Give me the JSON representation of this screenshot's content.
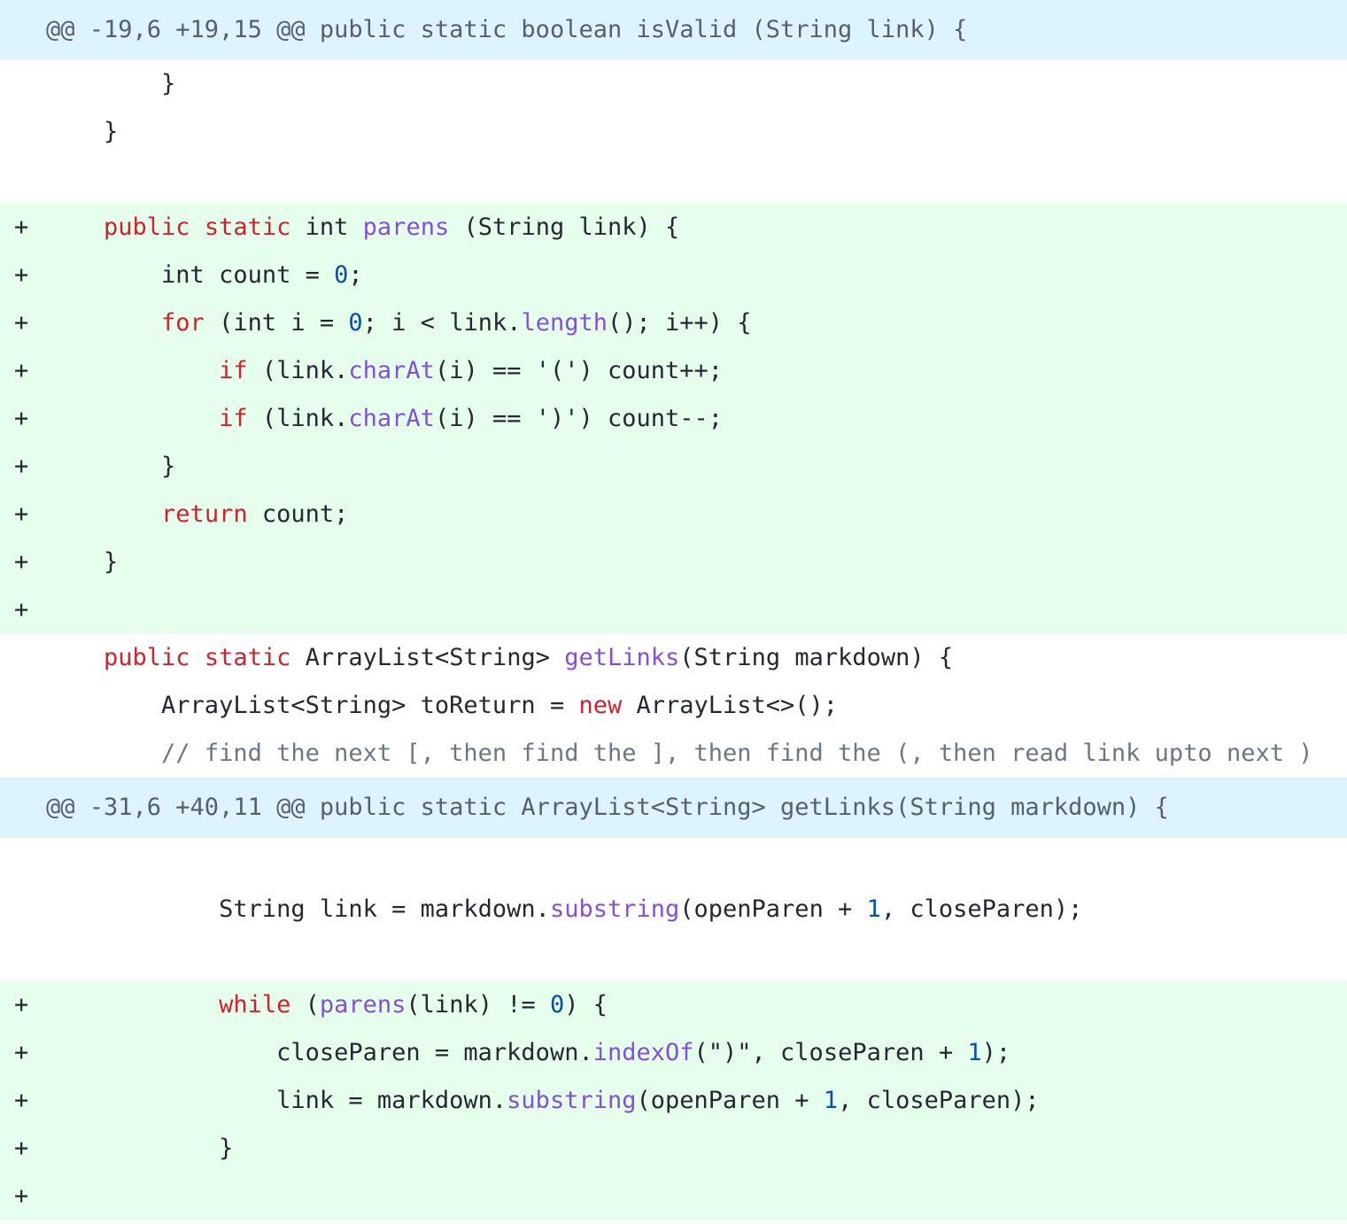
{
  "colors": {
    "hunk_bg": "#ddf4ff",
    "added_bg": "#e6ffec",
    "keyword": "#cf222e",
    "function": "#8250df",
    "number": "#0550ae",
    "comment": "#6e7781",
    "text": "#24292f"
  },
  "blocks": [
    {
      "type": "hunk",
      "text": "@@ -19,6 +19,15 @@ public static boolean isValid (String link) {"
    },
    {
      "type": "ctx",
      "tokens": [
        {
          "t": "p",
          "v": "        }"
        }
      ]
    },
    {
      "type": "ctx",
      "tokens": [
        {
          "t": "p",
          "v": "    }"
        }
      ]
    },
    {
      "type": "blank"
    },
    {
      "type": "add",
      "marker": "+",
      "tokens": [
        {
          "t": "p",
          "v": "    "
        },
        {
          "t": "k",
          "v": "public"
        },
        {
          "t": "p",
          "v": " "
        },
        {
          "t": "k",
          "v": "static"
        },
        {
          "t": "p",
          "v": " int "
        },
        {
          "t": "f",
          "v": "parens"
        },
        {
          "t": "p",
          "v": " (String link) {"
        }
      ]
    },
    {
      "type": "add",
      "marker": "+",
      "tokens": [
        {
          "t": "p",
          "v": "        int count = "
        },
        {
          "t": "n",
          "v": "0"
        },
        {
          "t": "p",
          "v": ";"
        }
      ]
    },
    {
      "type": "add",
      "marker": "+",
      "tokens": [
        {
          "t": "p",
          "v": "        "
        },
        {
          "t": "k",
          "v": "for"
        },
        {
          "t": "p",
          "v": " (int i = "
        },
        {
          "t": "n",
          "v": "0"
        },
        {
          "t": "p",
          "v": "; i < link."
        },
        {
          "t": "f",
          "v": "length"
        },
        {
          "t": "p",
          "v": "(); i++) {"
        }
      ]
    },
    {
      "type": "add",
      "marker": "+",
      "tokens": [
        {
          "t": "p",
          "v": "            "
        },
        {
          "t": "k",
          "v": "if"
        },
        {
          "t": "p",
          "v": " (link."
        },
        {
          "t": "f",
          "v": "charAt"
        },
        {
          "t": "p",
          "v": "(i) == '(') count++;"
        }
      ]
    },
    {
      "type": "add",
      "marker": "+",
      "tokens": [
        {
          "t": "p",
          "v": "            "
        },
        {
          "t": "k",
          "v": "if"
        },
        {
          "t": "p",
          "v": " (link."
        },
        {
          "t": "f",
          "v": "charAt"
        },
        {
          "t": "p",
          "v": "(i) == ')') count--;"
        }
      ]
    },
    {
      "type": "add",
      "marker": "+",
      "tokens": [
        {
          "t": "p",
          "v": "        }"
        }
      ]
    },
    {
      "type": "add",
      "marker": "+",
      "tokens": [
        {
          "t": "p",
          "v": "        "
        },
        {
          "t": "k",
          "v": "return"
        },
        {
          "t": "p",
          "v": " count;"
        }
      ]
    },
    {
      "type": "add",
      "marker": "+",
      "tokens": [
        {
          "t": "p",
          "v": "    }"
        }
      ]
    },
    {
      "type": "add",
      "marker": "+",
      "tokens": []
    },
    {
      "type": "ctx",
      "tokens": [
        {
          "t": "p",
          "v": "    "
        },
        {
          "t": "k",
          "v": "public"
        },
        {
          "t": "p",
          "v": " "
        },
        {
          "t": "k",
          "v": "static"
        },
        {
          "t": "p",
          "v": " ArrayList<String> "
        },
        {
          "t": "f",
          "v": "getLinks"
        },
        {
          "t": "p",
          "v": "(String markdown) {"
        }
      ]
    },
    {
      "type": "ctx",
      "tokens": [
        {
          "t": "p",
          "v": "        ArrayList<String> toReturn = "
        },
        {
          "t": "k",
          "v": "new"
        },
        {
          "t": "p",
          "v": " ArrayList<>();"
        }
      ]
    },
    {
      "type": "ctx",
      "tokens": [
        {
          "t": "p",
          "v": "        "
        },
        {
          "t": "c",
          "v": "// find the next [, then find the ], then find the (, then read link upto next )"
        }
      ]
    },
    {
      "type": "hunk",
      "text": "@@ -31,6 +40,11 @@ public static ArrayList<String> getLinks(String markdown) {"
    },
    {
      "type": "blank"
    },
    {
      "type": "ctx",
      "tokens": [
        {
          "t": "p",
          "v": "            String link = markdown."
        },
        {
          "t": "f",
          "v": "substring"
        },
        {
          "t": "p",
          "v": "(openParen + "
        },
        {
          "t": "n",
          "v": "1"
        },
        {
          "t": "p",
          "v": ", closeParen);"
        }
      ]
    },
    {
      "type": "blank"
    },
    {
      "type": "add",
      "marker": "+",
      "tokens": [
        {
          "t": "p",
          "v": "            "
        },
        {
          "t": "k",
          "v": "while"
        },
        {
          "t": "p",
          "v": " ("
        },
        {
          "t": "f",
          "v": "parens"
        },
        {
          "t": "p",
          "v": "(link) != "
        },
        {
          "t": "n",
          "v": "0"
        },
        {
          "t": "p",
          "v": ") {"
        }
      ]
    },
    {
      "type": "add",
      "marker": "+",
      "tokens": [
        {
          "t": "p",
          "v": "                closeParen = markdown."
        },
        {
          "t": "f",
          "v": "indexOf"
        },
        {
          "t": "p",
          "v": "(\")\", closeParen + "
        },
        {
          "t": "n",
          "v": "1"
        },
        {
          "t": "p",
          "v": ");"
        }
      ]
    },
    {
      "type": "add",
      "marker": "+",
      "tokens": [
        {
          "t": "p",
          "v": "                link = markdown."
        },
        {
          "t": "f",
          "v": "substring"
        },
        {
          "t": "p",
          "v": "(openParen + "
        },
        {
          "t": "n",
          "v": "1"
        },
        {
          "t": "p",
          "v": ", closeParen);"
        }
      ]
    },
    {
      "type": "add",
      "marker": "+",
      "tokens": [
        {
          "t": "p",
          "v": "            }"
        }
      ]
    },
    {
      "type": "add",
      "marker": "+",
      "tokens": []
    }
  ]
}
